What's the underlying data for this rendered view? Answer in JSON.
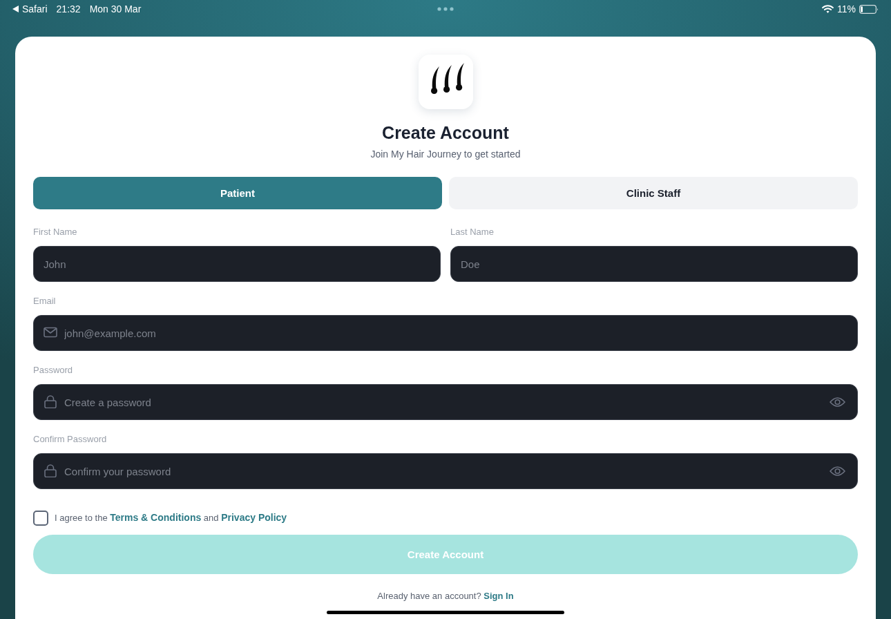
{
  "status_bar": {
    "back_app": "Safari",
    "time": "21:32",
    "date": "Mon 30 Mar",
    "battery": "11%"
  },
  "header": {
    "title": "Create Account",
    "subtitle": "Join My Hair Journey to get started"
  },
  "role_tabs": [
    {
      "label": "Patient",
      "selected": true
    },
    {
      "label": "Clinic Staff",
      "selected": false
    }
  ],
  "form_rows": [
    {
      "fields": [
        {
          "kind": "name",
          "label": "First Name",
          "placeholder": "John"
        },
        {
          "kind": "name",
          "label": "Last Name",
          "placeholder": "Doe"
        }
      ]
    },
    {
      "fields": [
        {
          "kind": "email",
          "label": "Email",
          "placeholder": "john@example.com"
        }
      ]
    },
    {
      "fields": [
        {
          "kind": "password",
          "label": "Password",
          "placeholder": "Create a password"
        }
      ]
    },
    {
      "fields": [
        {
          "kind": "password",
          "label": "Confirm Password",
          "placeholder": "Confirm your password"
        }
      ]
    }
  ],
  "agreement": {
    "checked": false,
    "parts": [
      {
        "kind": "text",
        "text": "I agree to the"
      },
      {
        "kind": "link",
        "text": "Terms & Conditions"
      },
      {
        "kind": "text",
        "text": "and"
      },
      {
        "kind": "link",
        "text": "Privacy Policy"
      }
    ]
  },
  "submit_button": {
    "label": "Create Account",
    "disabled": true
  },
  "footer": {
    "prompt": "Already have an account?",
    "link": "Sign In"
  }
}
